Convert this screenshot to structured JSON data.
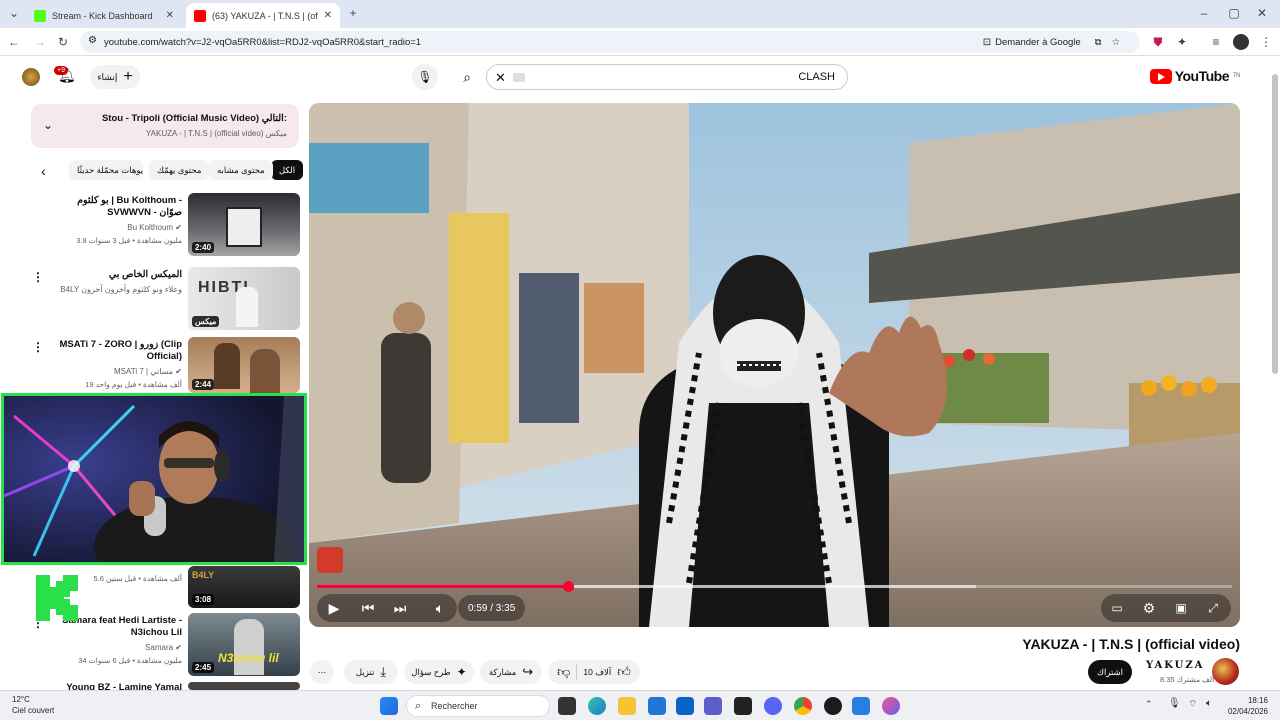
{
  "browser": {
    "tabs": [
      {
        "title": "Stream - Kick Dashboard",
        "active": false,
        "favicon_color": "#53fc18"
      },
      {
        "title": "(63) YAKUZA - | T.N.S | (official v",
        "active": true,
        "favicon_color": "#ff0000"
      }
    ],
    "url": "youtube.com/watch?v=J2-vqOa5RR0&list=RDJ2-vqOa5RR0&start_radio=1",
    "ask_google": "Demander à Google"
  },
  "header": {
    "search_value": "CLASH",
    "create_label": "إنشاء",
    "notification_badge": "+9",
    "logo_text": "YouTube",
    "logo_region": "TN"
  },
  "playlist": {
    "next_prefix": "التالي:",
    "next_title": "Stou - Tripoli (Official Music Video)",
    "next_sub": "YAKUZA - | T.N.S | (official video) ميكس"
  },
  "chips": [
    "الكل",
    "محتوى مشابه",
    "محتوى يهمّك",
    "فيديوهات محمّلة حديثًا"
  ],
  "recommendations": [
    {
      "title": "بو كلثوم | Bu Kolthoum - SVWWVN - صوّان",
      "channel": "Bu Kolthoum",
      "meta": "3.8 مليون مشاهدة • قبل 3 سنوات",
      "duration": "2:40",
      "verified": true
    },
    {
      "title": "الميكس الخاص بي",
      "channel": "B4LY وعلاء ونو كلثوم وآخرون آخرون",
      "meta": "",
      "duration": "ميكس",
      "verified": false
    },
    {
      "title": "MSATi 7 - ZORO | زورو (Clip Official)",
      "channel": "MSATi 7 | مساتي",
      "meta": "19 ألف مشاهدة • قبل يوم واحد",
      "duration": "2:44",
      "verified": true
    },
    {
      "title": "",
      "channel": "",
      "meta": "5.6 ألف مشاهدة • قبل ستين",
      "duration": "3:08",
      "verified": false
    },
    {
      "title": "Samara feat Hedi Lartiste - N3ichou Lil",
      "channel": "Samara",
      "meta": "34 مليون مشاهدة • قبل 6 سنوات",
      "duration": "2:45",
      "verified": true
    },
    {
      "title": "Young BZ - Lamine Yamal",
      "channel": "",
      "meta": "",
      "duration": "",
      "verified": false
    }
  ],
  "player": {
    "time_current": "0:59",
    "time_total": "3:35",
    "time_display": "0:59 / 3:35",
    "progress_fraction": 0.274,
    "buffer_fraction": 0.72
  },
  "video": {
    "title": "YAKUZA - | T.N.S | (official video)",
    "channel": "YAKUZA",
    "subscribers": "8.35 ألف مشترك",
    "subscribe_label": "اشتراك",
    "likes": "10 آلاف",
    "share_label": "مشاركة",
    "ask_label": "طرح سؤال",
    "download_label": "تنزيل"
  },
  "taskbar": {
    "temp": "12°C",
    "weather": "Ciel couvert",
    "search_placeholder": "Rechercher",
    "time": "18:16",
    "date": "02/04/2026"
  },
  "colors": {
    "accent_red": "#ff0033",
    "kick_green": "#29e04a"
  }
}
